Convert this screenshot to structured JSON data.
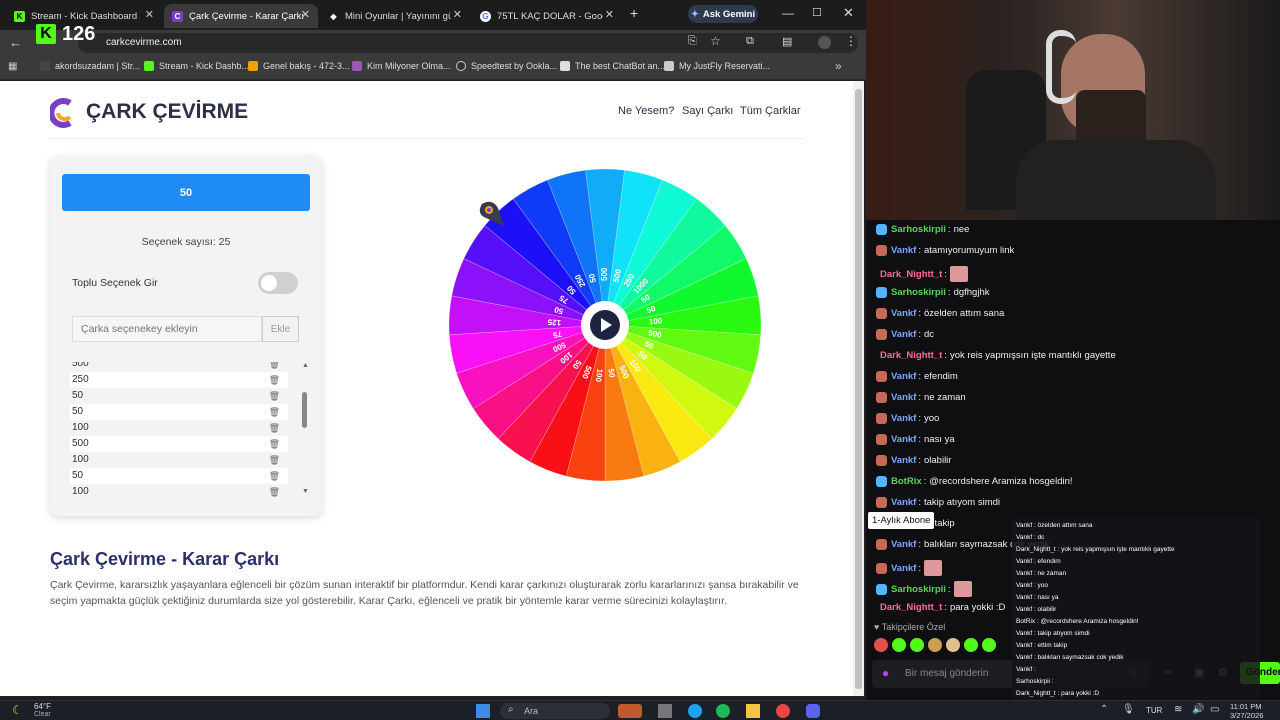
{
  "browser": {
    "tabs": [
      {
        "label": "Stream - Kick Dashboard",
        "icon": "kick-icon",
        "color": "#53fc18"
      },
      {
        "label": "Çark Çevirme - Karar Çarkı",
        "icon": "wheel-icon",
        "color": "#7b3fc4"
      },
      {
        "label": "Mini Oyunlar | Yayınını güçlen",
        "icon": "diamond-icon",
        "color": "#ffffff"
      },
      {
        "label": "75TL KAÇ DOLAR - Google'da",
        "icon": "google-icon",
        "color": "#4285f4"
      }
    ],
    "new_tab": "+",
    "ask_gemini": "Ask Gemini",
    "url": "carkcevirme.com",
    "bookmarks": [
      {
        "label": "akordsuzadam | Str..."
      },
      {
        "label": "Stream - Kick Dashb..."
      },
      {
        "label": "Genel bakış - 472-3..."
      },
      {
        "label": "Kim Milyoner Olma..."
      },
      {
        "label": "Speedtest by Ookla..."
      },
      {
        "label": "The best ChatBot an..."
      },
      {
        "label": "My JustFly Reservati..."
      }
    ],
    "more": "»"
  },
  "kick_overlay": {
    "count": "126"
  },
  "site": {
    "logo_text": "ÇARK ÇEVİRME",
    "nav": [
      "Ne Yesem?",
      "Sayı Çarkı",
      "Tüm Çarklar"
    ],
    "result": "50",
    "option_count": "Seçenek sayısı: 25",
    "bulk_toggle_label": "Toplu Seçenek Gir",
    "input_placeholder": "Çarka seçenekey ekleyin",
    "add_button": "Ekle",
    "options": [
      "500",
      "250",
      "50",
      "50",
      "100",
      "500",
      "100",
      "50",
      "100"
    ],
    "heading": "Çark Çevirme - Karar Çarkı",
    "description": "Çark Çevirme, kararsızlık yaşayanlara eğlenceli bir çözüm sunan interaktif bir platformdur. Kendi karar çarkınızı oluşturarak zorlu kararlarınızı şansa bırakabilir ve seçim yapmakta güçlük çektiğiniz durumlarda size yol gösterebilir. Karar Çarkı, eğlenceli ve pratik bir yöntemle karar verme sürecinizi kolaylaştırır."
  },
  "wheel": {
    "labels": [
      "500",
      "500",
      "250",
      "1000",
      "50",
      "50",
      "100",
      "500",
      "50",
      "50",
      "100",
      "500",
      "50",
      "100",
      "500",
      "50",
      "100",
      "500",
      "75",
      "125",
      "50",
      "75",
      "50",
      "250",
      "50"
    ]
  },
  "chat": {
    "messages": [
      {
        "user": "Sarhoskirpii",
        "text": "nee",
        "color": "#5ad65a"
      },
      {
        "user": "Vankf",
        "text": "atamıyorumuyum link",
        "color": "#7aa7ff"
      },
      {
        "user": "Dark_Nightt_t",
        "text": "",
        "color": "#ff6b9b"
      },
      {
        "user": "Sarhoskirpii",
        "text": "dgfhgjhk",
        "color": "#5ad65a"
      },
      {
        "user": "Vankf",
        "text": "özelden attım sana",
        "color": "#7aa7ff"
      },
      {
        "user": "Vankf",
        "text": "dc",
        "color": "#7aa7ff"
      },
      {
        "user": "Dark_Nightt_t",
        "text": "yok reis yapmışsın işte mantıklı gayette",
        "color": "#ff6b9b"
      },
      {
        "user": "Vankf",
        "text": "efendim",
        "color": "#7aa7ff"
      },
      {
        "user": "Vankf",
        "text": "ne zaman",
        "color": "#7aa7ff"
      },
      {
        "user": "Vankf",
        "text": "yoo",
        "color": "#7aa7ff"
      },
      {
        "user": "Vankf",
        "text": "nası ya",
        "color": "#7aa7ff"
      },
      {
        "user": "Vankf",
        "text": "olabilir",
        "color": "#7aa7ff"
      },
      {
        "user": "BotRix",
        "text": "@recordshere Aramiza hosgeldin!",
        "color": "#5ad65a"
      },
      {
        "user": "Vankf",
        "text": "takip atıyom simdi",
        "color": "#7aa7ff"
      },
      {
        "user": "Vankf",
        "text": "m takip",
        "color": "#7aa7ff"
      },
      {
        "user": "Vankf",
        "text": "balıkları saymazsak cok yedik",
        "color": "#7aa7ff"
      },
      {
        "user": "Vankf",
        "text": "",
        "color": "#7aa7ff"
      },
      {
        "user": "Sarhoskirpii",
        "text": "",
        "color": "#5ad65a"
      },
      {
        "user": "Dark_Nightt_t",
        "text": "para yokki :D",
        "color": "#ff6b9b"
      }
    ],
    "tooltip": "1-Aylık Abone",
    "followers_label": "Takipçilere Özel",
    "input_placeholder": "Bir mesaj gönderin",
    "send": "Gönder"
  },
  "overlay_chat": [
    "Vankf : özelden attım sana",
    "Vankf : dc",
    "Dark_Nightt_t : yok reis yapmışsın işte mantıklı gayette",
    "Vankf : efendim",
    "Vankf : ne zaman",
    "Vankf : yoo",
    "Vankf : nası ya",
    "Vankf : olabilir",
    "BotRix : @recordshere Aramiza hosgeldin!",
    "Vankf : takip atıyom simdi",
    "Vankf : ettim takip",
    "Vankf : balıkları saymazsak cok yedik",
    "Vankf :",
    "Sarhoskirpii :",
    "Dark_Nightt_t : para yokki :D"
  ],
  "taskbar": {
    "weather_temp": "64°F",
    "weather_desc": "Clear",
    "search": "Ara",
    "lang": "TUR",
    "time": "11:01 PM",
    "date": "3/27/2026"
  }
}
